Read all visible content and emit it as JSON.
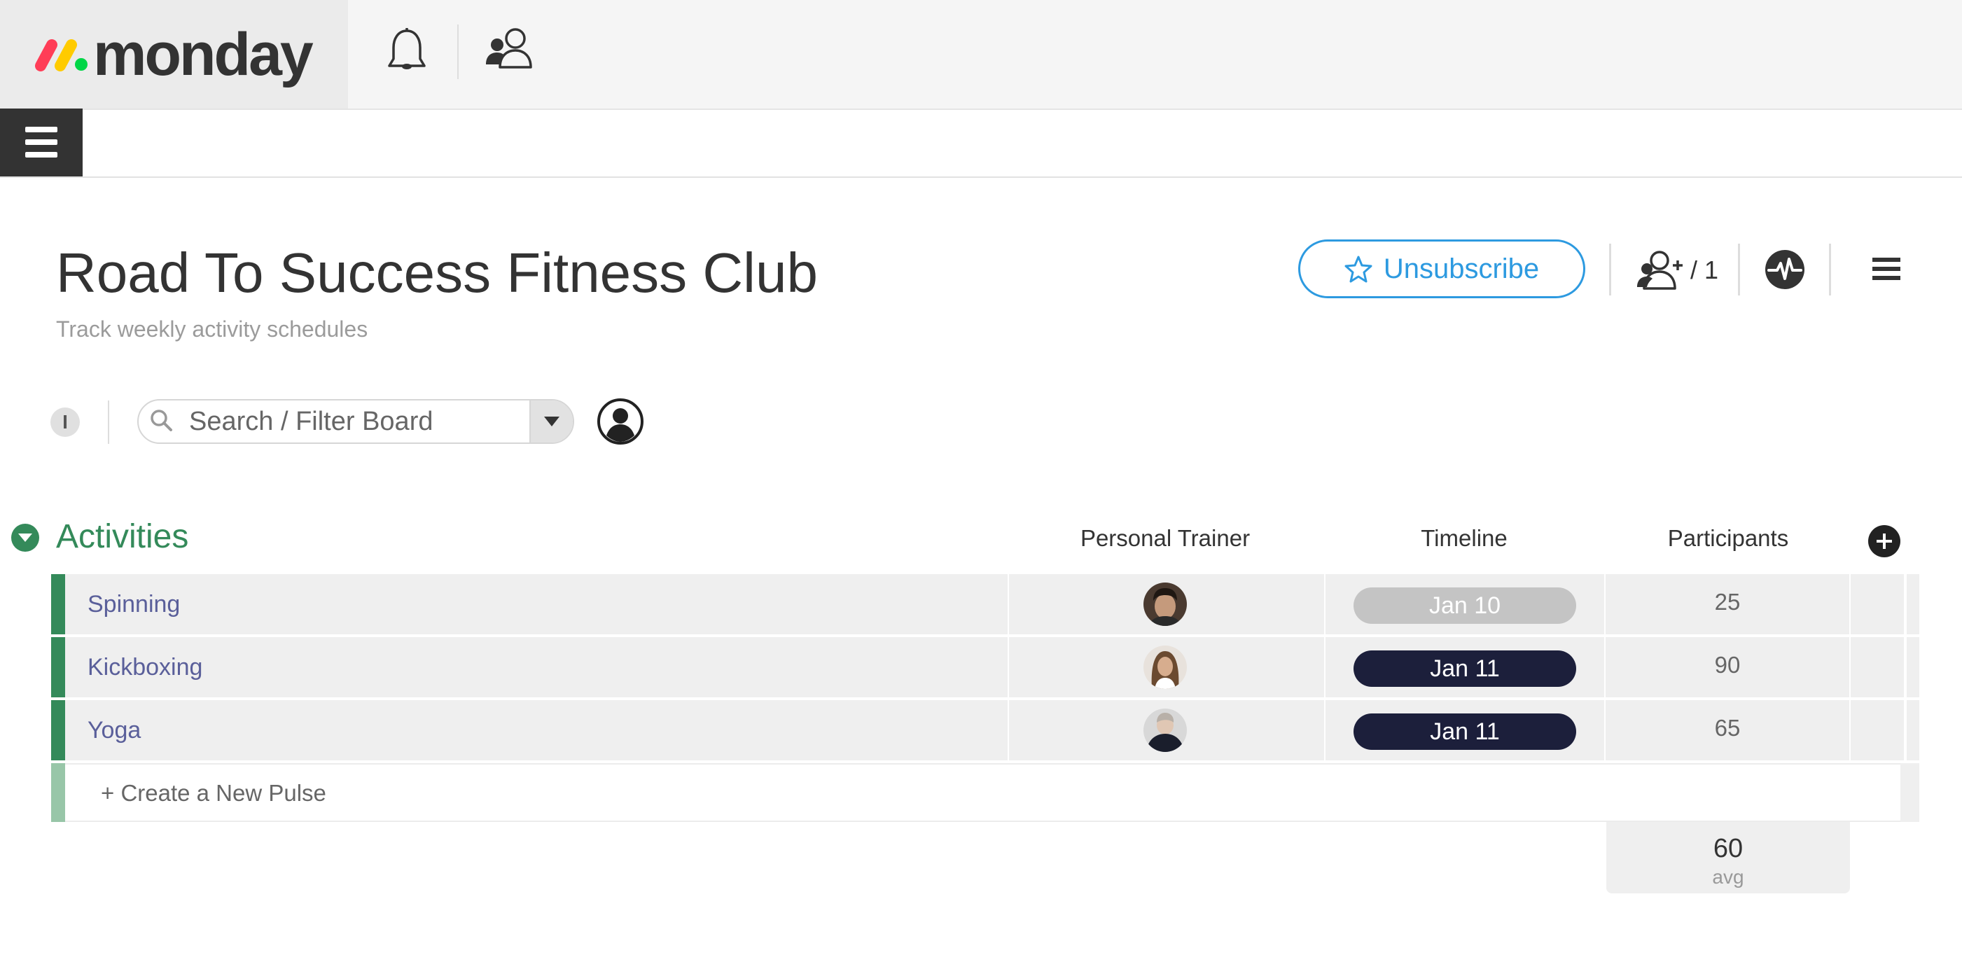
{
  "app": {
    "logo_text": "monday",
    "logo_colors": [
      "#ff3d57",
      "#ffcb00",
      "#00d647"
    ]
  },
  "topbar": {
    "icons": [
      "bell-icon",
      "invite-people-icon"
    ]
  },
  "board": {
    "title": "Road To Success Fitness Club",
    "description": "Track weekly activity schedules",
    "unsubscribe_label": "Unsubscribe",
    "subscribers_count": "/ 1",
    "accent_color": "#2d9ae0"
  },
  "filter": {
    "info_label": "I",
    "search_placeholder": "Search / Filter Board"
  },
  "group": {
    "title": "Activities",
    "color": "#348a5a",
    "columns": [
      "Personal Trainer",
      "Timeline",
      "Participants"
    ],
    "rows": [
      {
        "name": "Spinning",
        "trainer_avatar": "man-dark-hair",
        "timeline": "Jan 10",
        "timeline_color": "#c4c4c4",
        "participants": "25"
      },
      {
        "name": "Kickboxing",
        "trainer_avatar": "woman-long-hair",
        "timeline": "Jan 11",
        "timeline_color": "#1c1f3b",
        "participants": "90"
      },
      {
        "name": "Yoga",
        "trainer_avatar": "person-dark-jacket",
        "timeline": "Jan 11",
        "timeline_color": "#1c1f3b",
        "participants": "65"
      }
    ],
    "create_label": "+ Create a New Pulse",
    "summary": {
      "value": "60",
      "label": "avg"
    }
  }
}
